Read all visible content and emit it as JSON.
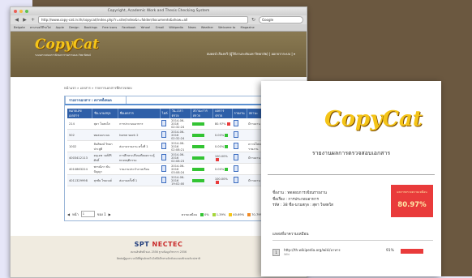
{
  "window": {
    "title": "Copyright, Academic Work and Thesis Checking System"
  },
  "toolbar": {
    "url": "http://www.copy-cat.in.th/copycat/index.php?r=site/index&r=folder/documents&show=all",
    "search_placeholder": "Google"
  },
  "bookmarks": [
    "Belgate",
    "ตามรอยวิถีรถไฟ",
    "Apple",
    "Design",
    "Bookings",
    "Free icons",
    "Facebook",
    "Yahoo!",
    "Gmail",
    "Wikipedia",
    "News",
    "Weather",
    "Welcome to",
    "Magazine"
  ],
  "site": {
    "logo": "CopyCat",
    "logo_sub": "ระบบตรวจสอบการลักลอกวรรณกรรมและวิทยานิพนธ์",
    "user_menu": "สมพงษ์ เรืองทวี (ผู้ใช้งานระดับมหาวิทยาลัย) | ออกจากระบบ | ▾"
  },
  "breadcrumb": "หน้าแรก » เอกสาร » รายการเอกสารที่ตรวจสอบ",
  "panel": {
    "tab": "รายการเอกสาร : ตรวจทั้งหมด",
    "columns": [
      "หมายเลขเอกสาร",
      "ชื่อ-นามสกุล",
      "ชื่อเอกสาร",
      "ไฟล์",
      "วัน-เวลาตรวจ",
      "สถานะการตรวจ",
      "ผลการตรวจ",
      "รายงาน",
      "สถานะ",
      "ลบ"
    ],
    "rows": [
      {
        "id": "214",
        "name": "สุดา ใจสดใส",
        "doc": "การประกอบอาหาร",
        "date": "2014-06-2016",
        "time": "02:32:24",
        "progress": 1.0,
        "result": "80.97%",
        "result_color": "#e93b3b",
        "status": "มีรายงาน แล้ว"
      },
      {
        "id": "502",
        "name": "ทดสอบระบบ",
        "doc": "home work 2",
        "date": "2014-06-2016",
        "time": "02:32:24",
        "progress": 1.0,
        "result": "0.00%",
        "result_color": "#33c433",
        "status": ""
      },
      {
        "id": "1002",
        "name": "สันติพงษ์ วิทยาประสูติ",
        "doc": "ส่งงานรายงาน ครั้งที่ 1",
        "date": "2014-06-2016",
        "time": "02:08:21",
        "progress": 1.0,
        "result": "0.00%",
        "result_color": "#33c433",
        "status": "ดาวน์โหลด รายงาน"
      },
      {
        "id": "4003412113",
        "name": "ดนุเดช วงศ์สิริศักดิ์",
        "doc": "การศึกษาเปรียบเทียบความรู้ทางพฤติกรรม",
        "date": "2014-06-2016",
        "time": "02:08:23",
        "progress": 1.0,
        "result": "100.00%",
        "result_color": "#e93b3b",
        "status": "มีรายงาน แล้ว"
      },
      {
        "id": "4010863224",
        "name": "พรรณิภา ขันปัญญา",
        "doc": "รายงานประจำภาคเรียน",
        "date": "2014-06-2016",
        "time": "03:08:24",
        "progress": 1.0,
        "result": "0.00%",
        "result_color": "#33c433",
        "status": ""
      },
      {
        "id": "4011329998",
        "name": "สุรชัย ไชยวงค์",
        "doc": "ส่งงานครั้งที่ 1",
        "date": "2014-06-2016",
        "time": "19:02:00",
        "progress": 1.0,
        "result": "100.00%",
        "result_color": "#e93b3b",
        "status": "มีรายงาน แล้ว"
      }
    ],
    "pager": {
      "label": "หน้า",
      "page": "1",
      "of": "ของ 1"
    },
    "legend": {
      "label": "ความเหมือน",
      "items": [
        {
          "text": "0%",
          "color": "#33c433"
        },
        {
          "text": "1-39%",
          "color": "#a6d63a"
        },
        {
          "text": "40-69%",
          "color": "#f5c518"
        },
        {
          "text": "70-79%",
          "color": "#f08a24"
        },
        {
          "text": "80%+",
          "color": "#e93b3b"
        }
      ]
    }
  },
  "footer": {
    "sponsor_left": "SPT",
    "sponsor_right": "NECTEC",
    "line1": "สงวนลิขสิทธิ์ พ.ศ. 2556 ฐานข้อมูลวิชาการ 2556",
    "line2": "ติดต่อผู้ดูแลระบบได้ที่ศูนย์เทคโนโลยีอิเล็กทรอนิกส์และคอมพิวเตอร์แห่งชาติ"
  },
  "report": {
    "logo": "CopyCat",
    "title": "รายงานผลการตรวจสอบเอกสาร",
    "info": [
      "ชื่องาน : ทดสอบการเขียนรายงาน",
      "ชื่อเรื่อง : การประกอบอาหาร",
      "รหัส : 38   ชื่อ-นามสกุล : สุดา ใจสดใส"
    ],
    "result_label": "ผลการตรวจความเหมือน",
    "result_percent": "80.97%",
    "section_title": "แหล่งที่มาความเหมือน",
    "sources": [
      {
        "num": "1",
        "url": "http://th.wikipedia.org/wiki/อาหาร",
        "domain": "Wiki",
        "percent": "91%"
      }
    ]
  }
}
